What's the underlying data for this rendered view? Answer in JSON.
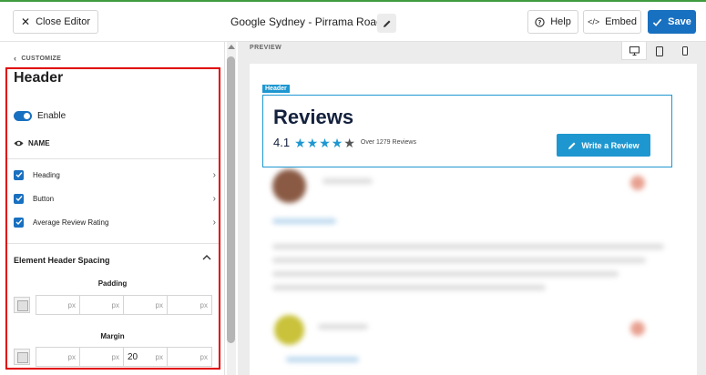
{
  "topbar": {
    "close_label": "Close Editor",
    "title": "Google Sydney - Pirrama Road",
    "help_label": "Help",
    "embed_label": "Embed",
    "save_label": "Save"
  },
  "sidebar": {
    "breadcrumb": "CUSTOMIZE",
    "title": "Header",
    "enable_label": "Enable",
    "name_label": "NAME",
    "items": [
      {
        "label": "Heading",
        "checked": true
      },
      {
        "label": "Button",
        "checked": true
      },
      {
        "label": "Average Review Rating",
        "checked": true
      }
    ],
    "spacing_section": "Element Header Spacing",
    "padding_label": "Padding",
    "padding_values": [
      "",
      "",
      "",
      ""
    ],
    "margin_label": "Margin",
    "margin_values": [
      "",
      "",
      "20",
      ""
    ],
    "unit": "px"
  },
  "preview": {
    "label": "PREVIEW",
    "header_tag": "Header",
    "reviews_title": "Reviews",
    "rating": "4.1",
    "stars_filled": 4,
    "stars_total": 5,
    "review_count": "Over 1279 Reviews",
    "write_review_label": "Write a Review"
  },
  "colors": {
    "accent": "#1870c0",
    "preview_accent": "#1e97d0",
    "highlight": "#e00000"
  }
}
